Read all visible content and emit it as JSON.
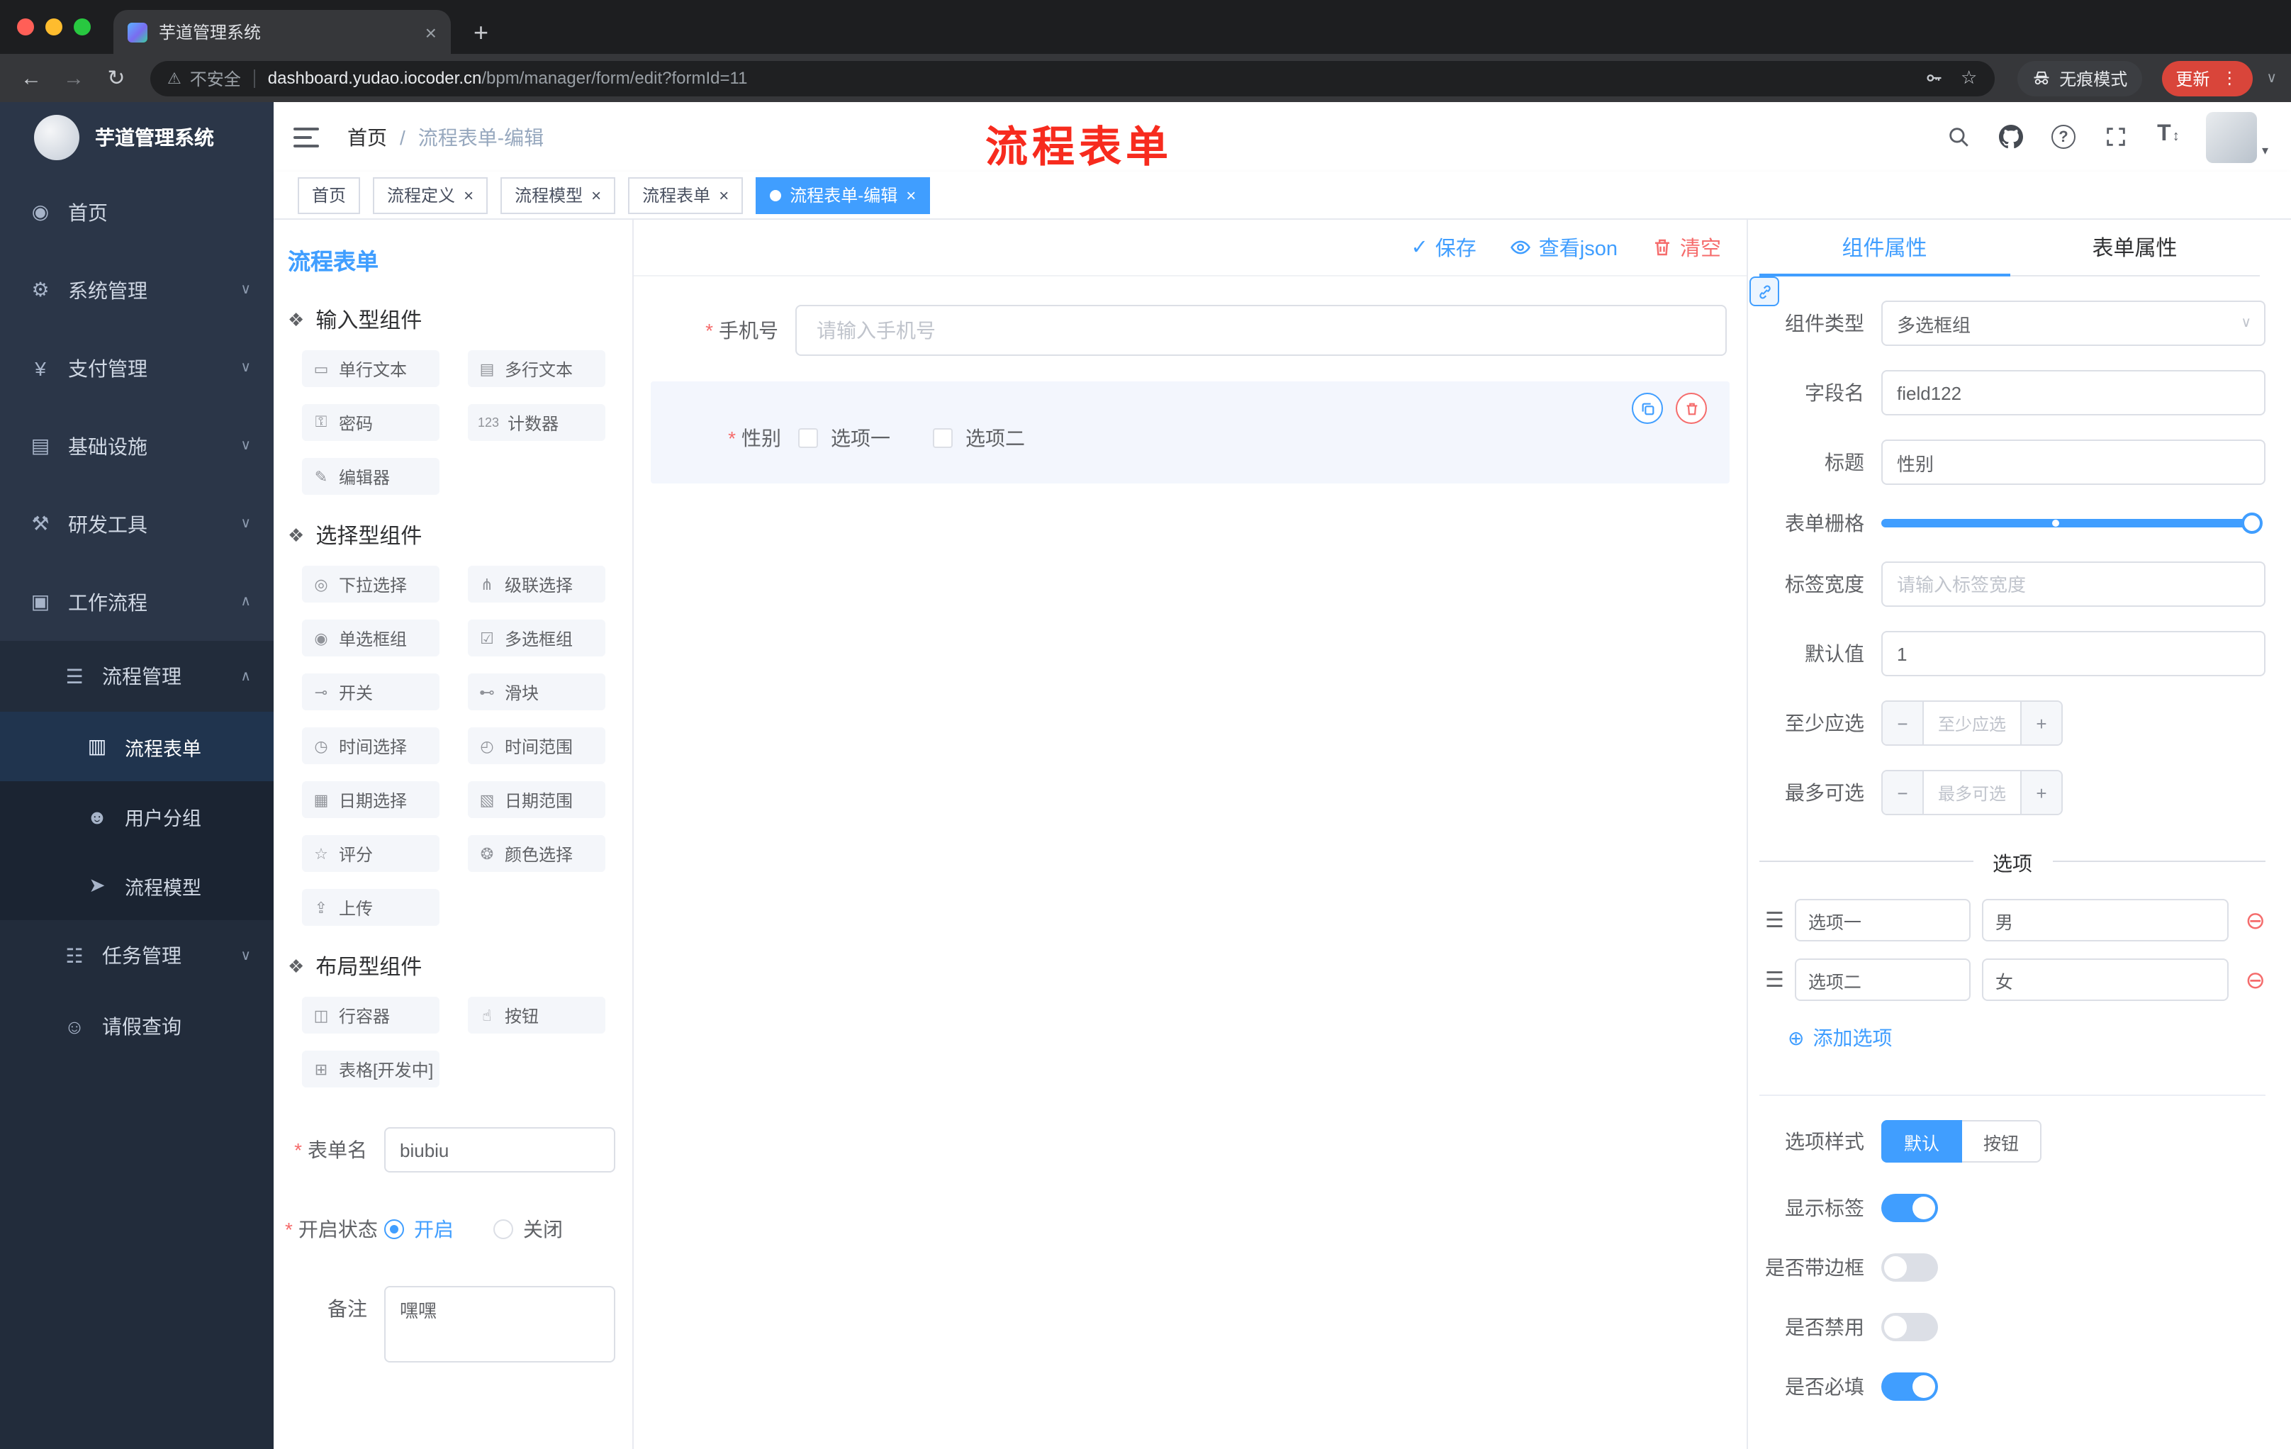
{
  "colors": {
    "accent": "#409eff",
    "danger": "#f56c6c",
    "annotation_red": "#f72b1e",
    "update_button": "#d9453a",
    "sidebar_bg": "#2b3648"
  },
  "icons": {
    "back": "←",
    "forward": "→",
    "reload": "↻",
    "warning": "⚠",
    "star": "☆",
    "dots": "⋮",
    "close": "×",
    "new_tab": "+",
    "chevron_down": "∨",
    "chevron_up": "∧",
    "caret_down": "▾",
    "check": "✓",
    "add_circle": "⊕",
    "remove_circle": "⊖",
    "drag_handle": "☰",
    "group_marker": "❖",
    "question": "?",
    "font_size": "T",
    "arrows_updown": "↕",
    "breadcrumb_sep": "/"
  },
  "browser": {
    "tab_title": "芋道管理系统",
    "security": "不安全",
    "host": "dashboard.yudao.iocoder.cn",
    "path": "/bpm/manager/form/edit?formId=11",
    "incognito": "无痕模式",
    "update": "更新"
  },
  "sidebar": {
    "logo_title": "芋道管理系统",
    "items": [
      {
        "label": "首页",
        "glyph": "◉"
      },
      {
        "label": "系统管理",
        "glyph": "⚙"
      },
      {
        "label": "支付管理",
        "glyph": "¥"
      },
      {
        "label": "基础设施",
        "glyph": "▤"
      },
      {
        "label": "研发工具",
        "glyph": "⚒"
      },
      {
        "label": "工作流程",
        "glyph": "▣"
      },
      {
        "label": "流程管理",
        "glyph": "☰"
      },
      {
        "label": "流程表单",
        "glyph": "▥"
      },
      {
        "label": "用户分组",
        "glyph": "☻"
      },
      {
        "label": "流程模型",
        "glyph": "➤"
      },
      {
        "label": "任务管理",
        "glyph": "☷"
      },
      {
        "label": "请假查询",
        "glyph": "☺"
      }
    ]
  },
  "header": {
    "breadcrumb_home": "首页",
    "breadcrumb_current": "流程表单-编辑",
    "annotation": "流程表单"
  },
  "tags": [
    {
      "label": "首页"
    },
    {
      "label": "流程定义"
    },
    {
      "label": "流程模型"
    },
    {
      "label": "流程表单"
    },
    {
      "label": "流程表单-编辑"
    }
  ],
  "palette": {
    "title": "流程表单",
    "groups": [
      {
        "title": "输入型组件",
        "items": [
          {
            "label": "单行文本",
            "glyph": "▭"
          },
          {
            "label": "多行文本",
            "glyph": "▤"
          },
          {
            "label": "密码",
            "glyph": "⚿"
          },
          {
            "label": "计数器",
            "glyph": "123"
          },
          {
            "label": "编辑器",
            "glyph": "✎"
          }
        ]
      },
      {
        "title": "选择型组件",
        "items": [
          {
            "label": "下拉选择",
            "glyph": "◎"
          },
          {
            "label": "级联选择",
            "glyph": "⋔"
          },
          {
            "label": "单选框组",
            "glyph": "◉"
          },
          {
            "label": "多选框组",
            "glyph": "☑"
          },
          {
            "label": "开关",
            "glyph": "⊸"
          },
          {
            "label": "滑块",
            "glyph": "⊷"
          },
          {
            "label": "时间选择",
            "glyph": "◷"
          },
          {
            "label": "时间范围",
            "glyph": "◴"
          },
          {
            "label": "日期选择",
            "glyph": "▦"
          },
          {
            "label": "日期范围",
            "glyph": "▧"
          },
          {
            "label": "评分",
            "glyph": "☆"
          },
          {
            "label": "颜色选择",
            "glyph": "❂"
          },
          {
            "label": "上传",
            "glyph": "⇪"
          }
        ]
      },
      {
        "title": "布局型组件",
        "items": [
          {
            "label": "行容器",
            "glyph": "◫"
          },
          {
            "label": "按钮",
            "glyph": "☝"
          },
          {
            "label": "表格[开发中]",
            "glyph": "⊞"
          }
        ]
      }
    ],
    "form_meta": {
      "name_label": "表单名",
      "name_value": "biubiu",
      "status_label": "开启状态",
      "status_on": "开启",
      "status_off": "关闭",
      "remark_label": "备注",
      "remark_value": "嘿嘿"
    }
  },
  "canvas": {
    "actions": {
      "save": "保存",
      "view_json": "查看json",
      "clear": "清空"
    },
    "phone": {
      "label": "手机号",
      "placeholder": "请输入手机号"
    },
    "gender": {
      "label": "性别",
      "option1": "选项一",
      "option2": "选项二"
    }
  },
  "properties": {
    "tab_component": "组件属性",
    "tab_form": "表单属性",
    "component_type_label": "组件类型",
    "component_type_value": "多选框组",
    "field_name_label": "字段名",
    "field_name_value": "field122",
    "title_label": "标题",
    "title_value": "性别",
    "grid_label": "表单栅格",
    "label_width_label": "标签宽度",
    "label_width_placeholder": "请输入标签宽度",
    "default_label": "默认值",
    "default_value": "1",
    "min_label": "至少应选",
    "min_placeholder": "至少应选",
    "max_label": "最多可选",
    "max_placeholder": "最多可选",
    "minus": "−",
    "plus": "+",
    "options_title": "选项",
    "options": [
      {
        "name": "选项一",
        "value": "男"
      },
      {
        "name": "选项二",
        "value": "女"
      }
    ],
    "add_option": "添加选项",
    "style_label": "选项样式",
    "style_default": "默认",
    "style_button": "按钮",
    "toggle_show_label": "显示标签",
    "toggle_border": "是否带边框",
    "toggle_disabled": "是否禁用",
    "toggle_required": "是否必填"
  }
}
